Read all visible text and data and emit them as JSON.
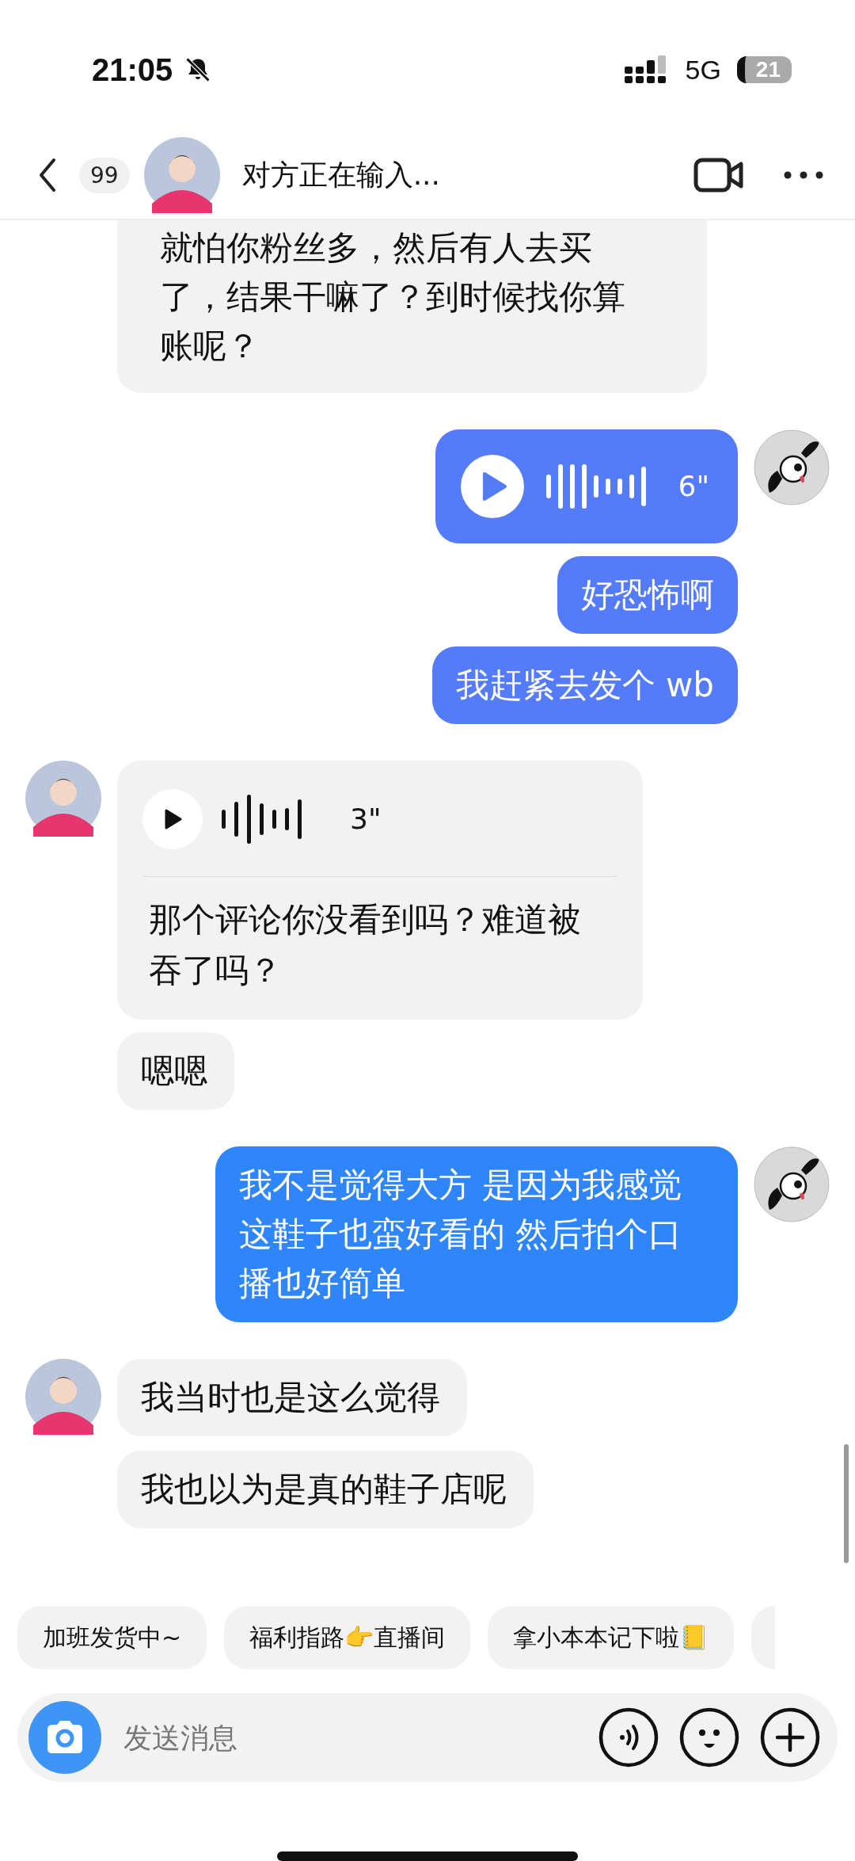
{
  "status_bar": {
    "time": "21:05",
    "network": "5G",
    "battery": "21"
  },
  "header": {
    "unread": "99",
    "title": "对方正在输入..."
  },
  "messages": [
    {
      "outgoing": false,
      "kind": "text",
      "avatar": false,
      "text": "就怕你粉丝多，然后有人去买了，结果干嘛了？到时候找你算账呢？"
    },
    {
      "outgoing": true,
      "kind": "voice",
      "avatar": true,
      "duration": "6\"",
      "color": "#547bfa"
    },
    {
      "outgoing": true,
      "kind": "text",
      "avatar": false,
      "text": "好恐怖啊",
      "color": "#547bfa"
    },
    {
      "outgoing": true,
      "kind": "text",
      "avatar": false,
      "text": "我赶紧去发个 wb",
      "color": "#547bfa"
    },
    {
      "outgoing": false,
      "kind": "voice",
      "avatar": true,
      "duration": "3\"",
      "text": "那个评论你没看到吗？难道被吞了吗？"
    },
    {
      "outgoing": false,
      "kind": "text",
      "avatar": false,
      "text": "嗯嗯"
    },
    {
      "outgoing": true,
      "kind": "text",
      "avatar": true,
      "text": "我不是觉得大方 是因为我感觉这鞋子也蛮好看的 然后拍个口播也好简单",
      "color": "#2f86fb"
    },
    {
      "outgoing": false,
      "kind": "text",
      "avatar": true,
      "text": "我当时也是这么觉得"
    },
    {
      "outgoing": false,
      "kind": "text",
      "avatar": false,
      "text": "我也以为是真的鞋子店呢"
    }
  ],
  "quick_replies": [
    "加班发货中~",
    "福利指路👉直播间",
    "拿小本本记下啦📒"
  ],
  "composer": {
    "placeholder": "发送消息"
  }
}
